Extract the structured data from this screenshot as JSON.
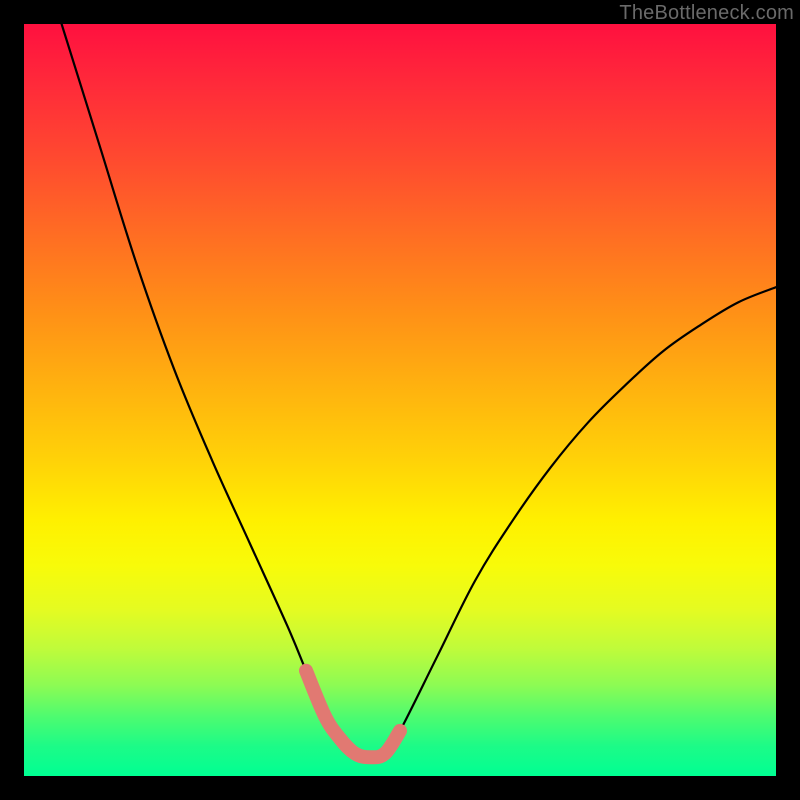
{
  "watermark": "TheBottleneck.com",
  "chart_data": {
    "type": "line",
    "title": "",
    "xlabel": "",
    "ylabel": "",
    "xlim": [
      0,
      100
    ],
    "ylim": [
      0,
      100
    ],
    "series": [
      {
        "name": "curve",
        "x": [
          5,
          10,
          15,
          20,
          25,
          30,
          35,
          37.5,
          40,
          42,
          44,
          46,
          48,
          50,
          55,
          60,
          65,
          70,
          75,
          80,
          85,
          90,
          95,
          100
        ],
        "y": [
          100,
          84,
          68,
          54,
          42,
          31,
          20,
          14,
          8,
          5,
          3,
          2.5,
          3,
          6,
          16,
          26,
          34,
          41,
          47,
          52,
          56.5,
          60,
          63,
          65
        ]
      }
    ],
    "highlight_segment": {
      "name": "trough-highlight",
      "color": "#e17972",
      "x": [
        37.5,
        40,
        42,
        44,
        46,
        48,
        50
      ],
      "y": [
        14,
        8,
        5,
        3,
        2.5,
        3,
        6
      ]
    },
    "colors": {
      "curve": "#000000",
      "highlight": "#e17972",
      "background_top": "#ff103f",
      "background_bottom": "#00ff93",
      "frame": "#000000"
    }
  }
}
